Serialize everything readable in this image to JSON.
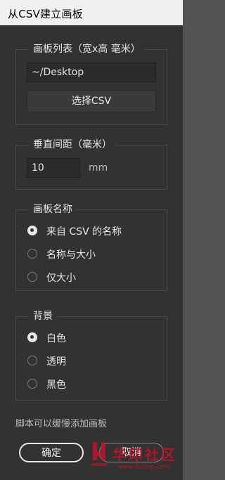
{
  "window": {
    "title": "从CSV建立画板"
  },
  "artboard_list": {
    "legend": "画板列表（宽x高 毫米）",
    "path_value": "~/Desktop",
    "select_button": "选择CSV"
  },
  "vertical_spacing": {
    "legend": "垂直间距（毫米）",
    "value": "10",
    "unit": "mm"
  },
  "artboard_name": {
    "legend": "画板名称",
    "options": [
      {
        "label": "来自 CSV 的名称",
        "checked": true
      },
      {
        "label": "名称与大小",
        "checked": false
      },
      {
        "label": "仅大小",
        "checked": false
      }
    ]
  },
  "background": {
    "legend": "背景",
    "options": [
      {
        "label": "白色",
        "checked": true
      },
      {
        "label": "透明",
        "checked": false
      },
      {
        "label": "黑色",
        "checked": false
      }
    ]
  },
  "footnote": "脚本可以缓慢添加画板",
  "buttons": {
    "ok": "确定",
    "cancel": "取消"
  },
  "watermark": {
    "brand": "华印社区",
    "url": "www.52cnp.com",
    "color": "#c8102e"
  },
  "colors": {
    "dialog_bg": "#323232",
    "titlebar_bg": "#f0f0f0",
    "field_bg": "#2b2b2b"
  }
}
